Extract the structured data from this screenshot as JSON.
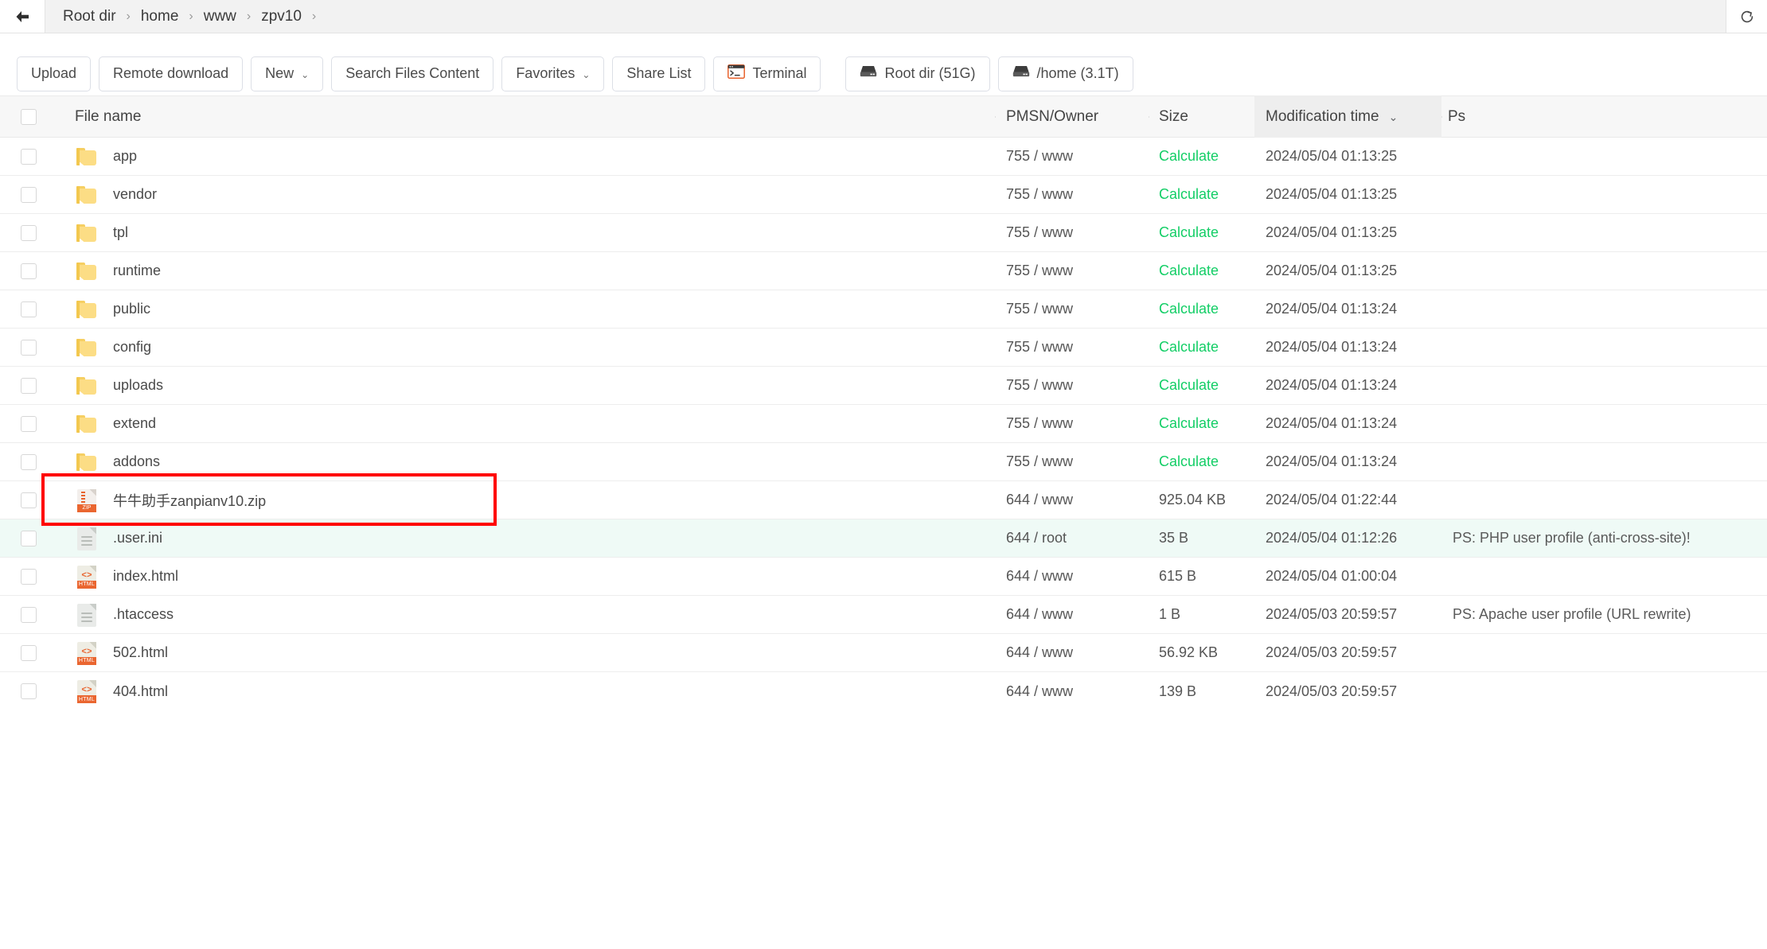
{
  "breadcrumb": {
    "back_icon": "arrow-left-icon",
    "refresh_icon": "refresh-icon",
    "separator": "›",
    "items": [
      "Root dir",
      "home",
      "www",
      "zpv10"
    ]
  },
  "toolbar": {
    "buttons": [
      {
        "label": "Upload",
        "icon": null,
        "caret": false
      },
      {
        "label": "Remote download",
        "icon": null,
        "caret": false
      },
      {
        "label": "New",
        "icon": null,
        "caret": true
      },
      {
        "label": "Search Files Content",
        "icon": null,
        "caret": false
      },
      {
        "label": "Favorites",
        "icon": null,
        "caret": true
      },
      {
        "label": "Share List",
        "icon": null,
        "caret": false
      },
      {
        "label": "Terminal",
        "icon": "terminal-icon",
        "caret": false
      },
      {
        "label": "Root dir (51G)",
        "icon": "disk-icon",
        "caret": false
      },
      {
        "label": "/home (3.1T)",
        "icon": "disk-icon",
        "caret": false
      }
    ],
    "caret_glyph": "⌄"
  },
  "table": {
    "columns": {
      "name": "File name",
      "perm": "PMSN/Owner",
      "size": "Size",
      "time": "Modification time",
      "ps": "Ps"
    },
    "sort": {
      "column": "Modification time",
      "caret": "⌄"
    },
    "calculate_label": "Calculate",
    "calculate_color": "#13ce66",
    "rows": [
      {
        "icon": "folder-icon",
        "name": "app",
        "perm": "755 / www",
        "size": "Calculate",
        "size_is_link": true,
        "time": "2024/05/04 01:13:25",
        "ps": "",
        "selected": false,
        "highlight": false
      },
      {
        "icon": "folder-icon",
        "name": "vendor",
        "perm": "755 / www",
        "size": "Calculate",
        "size_is_link": true,
        "time": "2024/05/04 01:13:25",
        "ps": "",
        "selected": false,
        "highlight": false
      },
      {
        "icon": "folder-icon",
        "name": "tpl",
        "perm": "755 / www",
        "size": "Calculate",
        "size_is_link": true,
        "time": "2024/05/04 01:13:25",
        "ps": "",
        "selected": false,
        "highlight": false
      },
      {
        "icon": "folder-icon",
        "name": "runtime",
        "perm": "755 / www",
        "size": "Calculate",
        "size_is_link": true,
        "time": "2024/05/04 01:13:25",
        "ps": "",
        "selected": false,
        "highlight": false
      },
      {
        "icon": "folder-icon",
        "name": "public",
        "perm": "755 / www",
        "size": "Calculate",
        "size_is_link": true,
        "time": "2024/05/04 01:13:24",
        "ps": "",
        "selected": false,
        "highlight": false
      },
      {
        "icon": "folder-icon",
        "name": "config",
        "perm": "755 / www",
        "size": "Calculate",
        "size_is_link": true,
        "time": "2024/05/04 01:13:24",
        "ps": "",
        "selected": false,
        "highlight": false
      },
      {
        "icon": "folder-icon",
        "name": "uploads",
        "perm": "755 / www",
        "size": "Calculate",
        "size_is_link": true,
        "time": "2024/05/04 01:13:24",
        "ps": "",
        "selected": false,
        "highlight": false
      },
      {
        "icon": "folder-icon",
        "name": "extend",
        "perm": "755 / www",
        "size": "Calculate",
        "size_is_link": true,
        "time": "2024/05/04 01:13:24",
        "ps": "",
        "selected": false,
        "highlight": false
      },
      {
        "icon": "folder-icon",
        "name": "addons",
        "perm": "755 / www",
        "size": "Calculate",
        "size_is_link": true,
        "time": "2024/05/04 01:13:24",
        "ps": "",
        "selected": false,
        "highlight": false
      },
      {
        "icon": "zip-file-icon",
        "name": "牛牛助手zanpianv10.zip",
        "perm": "644 / www",
        "size": "925.04 KB",
        "size_is_link": false,
        "time": "2024/05/04 01:22:44",
        "ps": "",
        "selected": false,
        "highlight": true
      },
      {
        "icon": "text-file-icon",
        "name": ".user.ini",
        "perm": "644 / root",
        "size": "35 B",
        "size_is_link": false,
        "time": "2024/05/04 01:12:26",
        "ps": "PS: PHP user profile (anti-cross-site)!",
        "selected": true,
        "highlight": false
      },
      {
        "icon": "html-file-icon",
        "name": "index.html",
        "perm": "644 / www",
        "size": "615 B",
        "size_is_link": false,
        "time": "2024/05/04 01:00:04",
        "ps": "",
        "selected": false,
        "highlight": false
      },
      {
        "icon": "text-file-icon",
        "name": ".htaccess",
        "perm": "644 / www",
        "size": "1 B",
        "size_is_link": false,
        "time": "2024/05/03 20:59:57",
        "ps": "PS: Apache user profile (URL rewrite)",
        "selected": false,
        "highlight": false
      },
      {
        "icon": "html-file-icon",
        "name": "502.html",
        "perm": "644 / www",
        "size": "56.92 KB",
        "size_is_link": false,
        "time": "2024/05/03 20:59:57",
        "ps": "",
        "selected": false,
        "highlight": false
      },
      {
        "icon": "html-file-icon",
        "name": "404.html",
        "perm": "644 / www",
        "size": "139 B",
        "size_is_link": false,
        "time": "2024/05/03 20:59:57",
        "ps": "",
        "selected": false,
        "highlight": false
      }
    ]
  },
  "annotation": {
    "color": "#ff0000"
  }
}
